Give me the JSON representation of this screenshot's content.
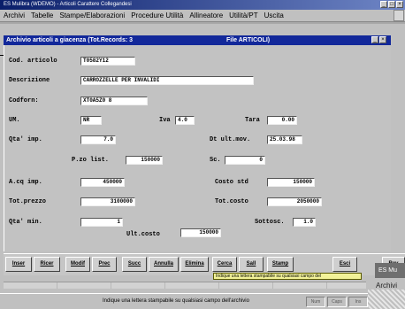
{
  "app": {
    "title": "ES Mulibra (WDEMO) - Articoli Carattere Collegandesi"
  },
  "menu": [
    "Archivi",
    "Tabelle",
    "Stampe/Elaborazioni",
    "Procedure Utilità",
    "Allineatore",
    "Utilità/PT",
    "Uscita"
  ],
  "form": {
    "title": "Archivio articoli a giacenza (Tot.Records: 3",
    "file_label": "File ARTICOLI)",
    "codice_label": "Cod. articolo",
    "codice_value": "T0582Y12",
    "descrizione_label": "Descrizione",
    "descrizione_value": "CARROZZELLE PER INVALIDI",
    "codforn_label": "Codforn:",
    "codforn_value": "XT0A5Z0 8",
    "um_label": "UM.",
    "um_value": "NR",
    "iva_label": "Iva",
    "iva_value": "4.0",
    "tara_label": "Tara",
    "tara_value": "0.00",
    "qta_imp_label": "Qta' imp.",
    "qta_imp_value": "7.0",
    "dt_ult_mov_label": "Dt ult.mov.",
    "dt_ult_mov_value": "25.03.98",
    "pu_list_label": "P.zo list.",
    "pu_list_value": "150000",
    "sc_label": "Sc.",
    "sc_value": "0",
    "acq_imp_label": "A.cq imp.",
    "acq_imp_value": "450000",
    "costo_std_label": "Costo std",
    "costo_std_value": "150000",
    "tot_prezzo_label": "Tot.prezzo",
    "tot_prezzo_value": "3100000",
    "tot_costo_label": "Tot.costo",
    "tot_costo_value": "2050000",
    "qta_min_label": "Qta' min.",
    "qta_min_value": "1",
    "sottoscorta_label": "Sottosc.",
    "sottoscorta_value": "1.0",
    "ult_costo_label": "Ult.costo",
    "ult_costo_value": "150000"
  },
  "toolbar": {
    "buttons": [
      "Inser",
      "Ricer",
      "Modif",
      "Prec",
      "Succ",
      "Annulla",
      "Elimina",
      "Cerca",
      "Sall",
      "Stamp",
      "Esci",
      "Rev"
    ]
  },
  "tooltip": "Indique una lettera stampabile su qualsiasi campo del",
  "status": {
    "message": "Indique una lettera stampabile su qualsiasi campo dell'archivio",
    "panels": [
      "Num",
      "Caps",
      "Ins"
    ]
  },
  "taskbar": {
    "box_label": "ES Mu",
    "desktop_label": "Archivi"
  }
}
